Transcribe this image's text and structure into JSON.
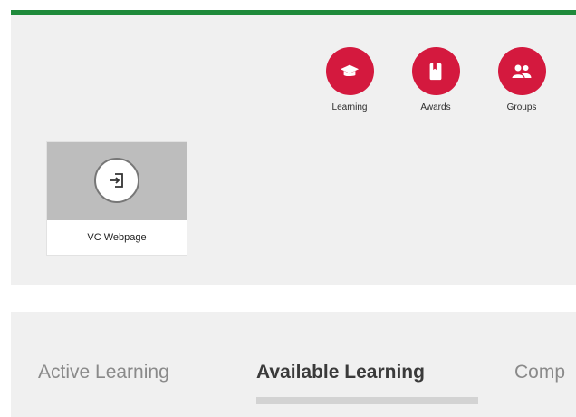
{
  "colors": {
    "accent_green": "#1f8a3b",
    "icon_red": "#d4193e",
    "panel_bg": "#f0f0f0"
  },
  "quick_links": [
    {
      "label": "Learning",
      "icon": "graduation-cap-icon"
    },
    {
      "label": "Awards",
      "icon": "book-bookmark-icon"
    },
    {
      "label": "Groups",
      "icon": "people-icon"
    }
  ],
  "tile": {
    "label": "VC Webpage",
    "icon": "sign-in-icon"
  },
  "tabs": [
    {
      "label": "Active Learning",
      "active": false
    },
    {
      "label": "Available Learning",
      "active": true
    },
    {
      "label": "Comp",
      "active": false
    }
  ]
}
